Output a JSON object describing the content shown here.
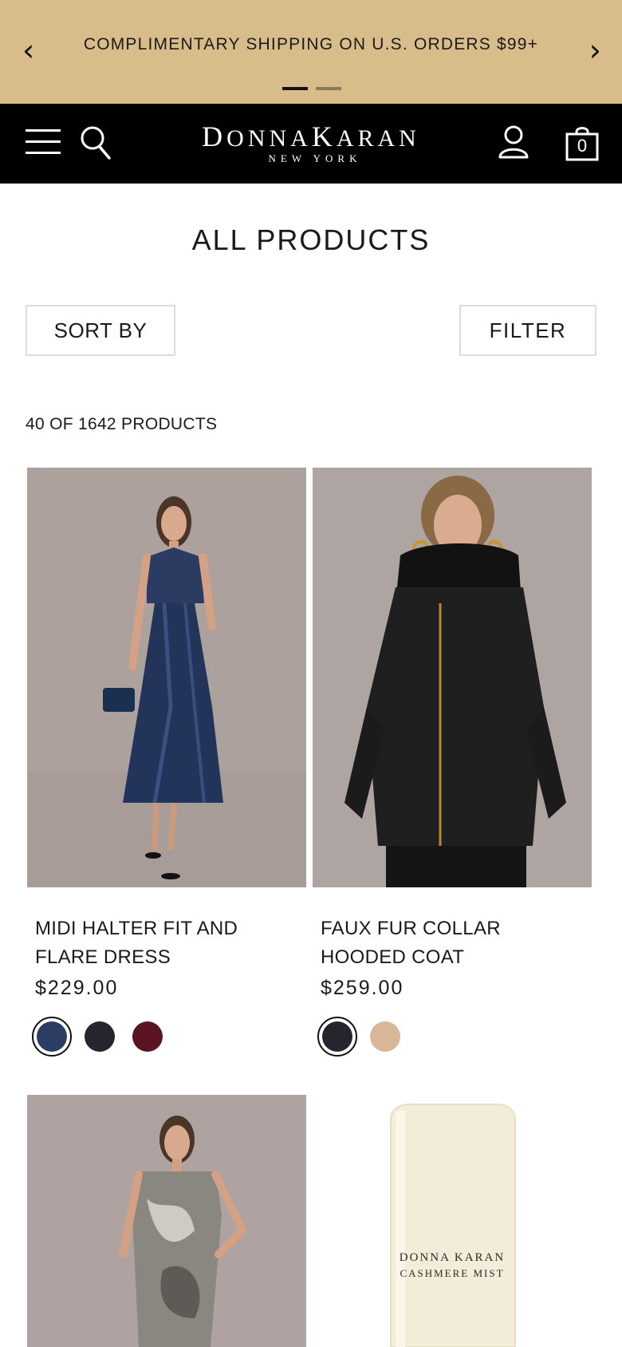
{
  "promo": {
    "text": "COMPLIMENTARY SHIPPING ON U.S. ORDERS $99+",
    "prev": "‹",
    "next": "›"
  },
  "header": {
    "logo_first_big": "D",
    "logo_first": "ONNA",
    "logo_second_big": "K",
    "logo_second": "ARAN",
    "logo_sub": "NEW YORK",
    "bag_count": "0"
  },
  "page": {
    "title": "ALL PRODUCTS",
    "sort_label": "SORT BY",
    "filter_label": "FILTER",
    "count": "40 OF 1642 PRODUCTS"
  },
  "products": [
    {
      "name": "MIDI HALTER FIT AND FLARE DRESS",
      "price": "$229.00",
      "swatches": [
        "#2c3d63",
        "#25262d",
        "#5a1422"
      ]
    },
    {
      "name": "FAUX FUR COLLAR HOODED COAT",
      "price": "$259.00",
      "swatches": [
        "#25262d",
        "#d8b698"
      ]
    },
    {
      "name": "",
      "price": ""
    },
    {
      "name": "",
      "price": "",
      "label_brand": "DONNA KARAN",
      "label_product": "CASHMERE MIST"
    }
  ],
  "colors": {
    "promo_bg": "#d8bd8a",
    "header_bg": "#000000",
    "image_bg": "#aea3a0"
  }
}
